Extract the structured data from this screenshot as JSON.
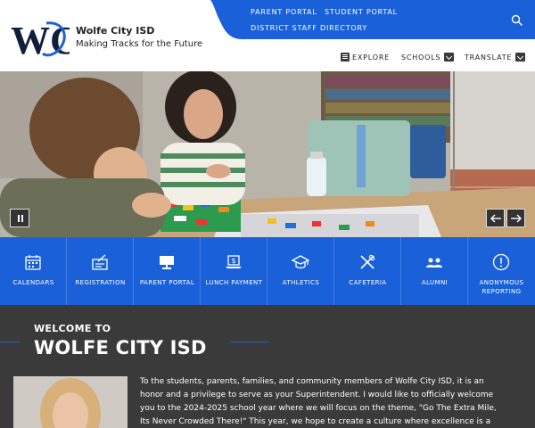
{
  "site": {
    "name": "Wolfe City ISD",
    "tagline": "Making Tracks for the Future",
    "logo_text": "WC"
  },
  "top_links": [
    "PARENT PORTAL",
    "STUDENT PORTAL",
    "DISTRICT STAFF DIRECTORY"
  ],
  "main_nav": [
    {
      "label": "EXPLORE",
      "icon": "menu-icon"
    },
    {
      "label": "SCHOOLS",
      "icon": "chevron-down-icon"
    },
    {
      "label": "TRANSLATE",
      "icon": "chevron-down-icon"
    }
  ],
  "slider": {
    "controls": [
      "pause-icon",
      "arrow-left-icon",
      "arrow-right-icon"
    ]
  },
  "quick_links": [
    {
      "label": "CALENDARS",
      "icon": "calendar-icon"
    },
    {
      "label": "REGISTRATION",
      "icon": "clipboard-icon"
    },
    {
      "label": "PARENT PORTAL",
      "icon": "monitor-icon"
    },
    {
      "label": "LUNCH PAYMENT",
      "icon": "laptop-dollar-icon"
    },
    {
      "label": "ATHLETICS",
      "icon": "mortarboard-icon"
    },
    {
      "label": "CAFETERIA",
      "icon": "utensils-icon"
    },
    {
      "label": "ALUMNI",
      "icon": "people-icon"
    },
    {
      "label": "ANONYMOUS REPORTING",
      "icon": "alert-icon"
    }
  ],
  "welcome": {
    "kicker": "WELCOME TO",
    "title": "WOLFE CITY ISD",
    "text": "To the students, parents, families, and community members of Wolfe City ISD, it is an honor and a privilege to serve as your Superintendent. I would like to officially welcome you to the 2024-2025 school year where we will focus on the theme, \"Go The Extra Mile, Its Never Crowded There!\" This year, we hope to create a culture where excellence is a"
  },
  "colors": {
    "brand_blue": "#1a61d9",
    "dark_section": "#3a3a3a"
  }
}
